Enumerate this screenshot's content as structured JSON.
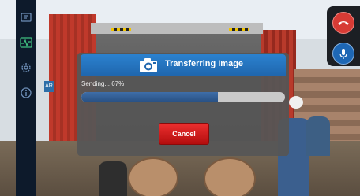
{
  "dialog": {
    "title": "Transferring Image",
    "status": "Sending... 67%",
    "progress": 0.67,
    "cancel_label": "Cancel",
    "camera_icon": "camera-icon"
  },
  "sidebar": {
    "icons": [
      "image-icon",
      "activity-icon",
      "settings-icon",
      "info-icon"
    ]
  },
  "call_controls": {
    "end_call_icon": "end-call-icon",
    "mic_icon": "microphone-icon",
    "end_call_color": "#d73b35",
    "mic_color": "#1e67b4"
  },
  "colors": {
    "header": "#1f66ad",
    "progress_fill": "#274f82",
    "cancel": "#d11a1a"
  }
}
